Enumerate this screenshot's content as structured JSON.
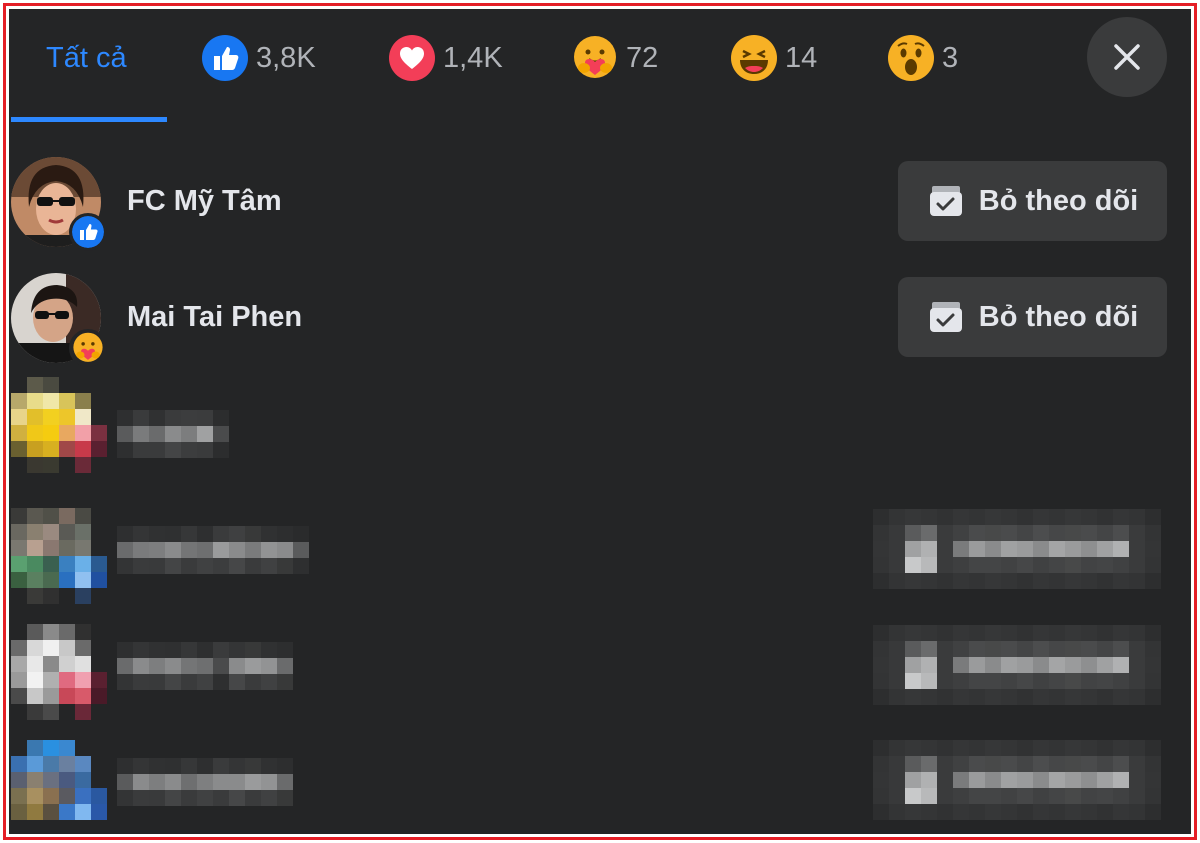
{
  "tabs": {
    "all_label": "Tất cả",
    "items": [
      {
        "reaction": "like-icon",
        "count": "3,8K"
      },
      {
        "reaction": "love-icon",
        "count": "1,4K"
      },
      {
        "reaction": "care-icon",
        "count": "72"
      },
      {
        "reaction": "haha-icon",
        "count": "14"
      },
      {
        "reaction": "wow-icon",
        "count": "3"
      }
    ]
  },
  "close": {
    "icon": "close-icon"
  },
  "people": [
    {
      "name": "FC Mỹ Tâm",
      "reaction": "like-icon",
      "button": "Bỏ theo dõi"
    },
    {
      "name": "Mai Tai Phen",
      "reaction": "care-icon",
      "button": "Bỏ theo dõi"
    }
  ],
  "colors": {
    "background": "#242526",
    "accent": "#2d88ff",
    "button_bg": "#3a3b3c",
    "text": "#e4e6eb",
    "muted_text": "#b0b3b8",
    "frame_border": "#e41e26"
  }
}
